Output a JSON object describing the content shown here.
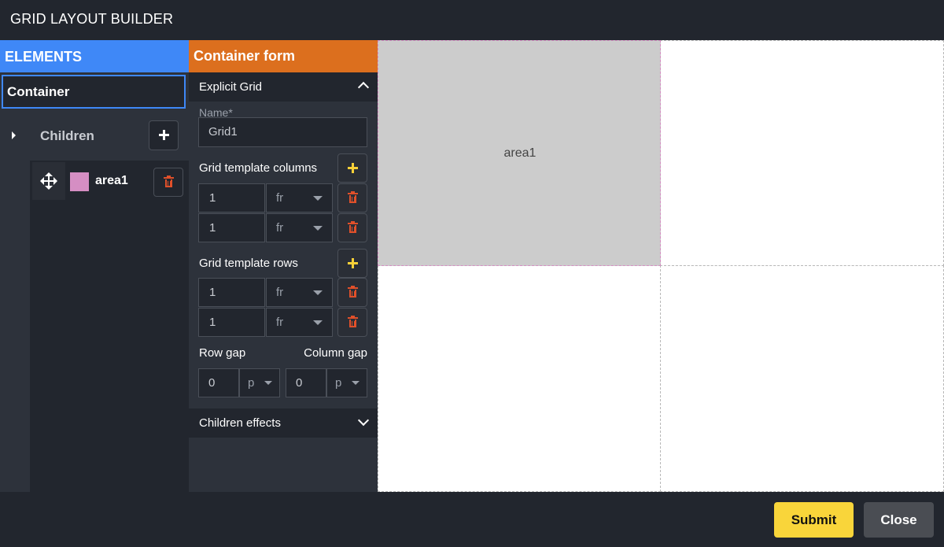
{
  "app": {
    "title": "GRID LAYOUT BUILDER"
  },
  "elements_panel": {
    "header": "ELEMENTS",
    "container_label": "Container",
    "children_label": "Children",
    "children": [
      {
        "name": "area1",
        "color": "#d58ec3"
      }
    ]
  },
  "form": {
    "header": "Container form",
    "explicit_grid": {
      "title": "Explicit Grid",
      "name_label": "Name*",
      "name_value": "Grid1",
      "columns_label": "Grid template columns",
      "columns": [
        {
          "value": "1",
          "unit": "fr"
        },
        {
          "value": "1",
          "unit": "fr"
        }
      ],
      "rows_label": "Grid template rows",
      "rows": [
        {
          "value": "1",
          "unit": "fr"
        },
        {
          "value": "1",
          "unit": "fr"
        }
      ],
      "row_gap_label": "Row gap",
      "row_gap_value": "0",
      "row_gap_unit": "p",
      "column_gap_label": "Column gap",
      "column_gap_value": "0",
      "column_gap_unit": "p"
    },
    "children_effects": {
      "title": "Children effects"
    }
  },
  "preview": {
    "area_label": "area1"
  },
  "footer": {
    "submit_label": "Submit",
    "close_label": "Close"
  },
  "colors": {
    "elements_header": "#3f88f7",
    "form_header": "#dc6f1e",
    "submit": "#f9d53a",
    "area_fill": "#cccccc",
    "area_swatch": "#d58ec3"
  }
}
